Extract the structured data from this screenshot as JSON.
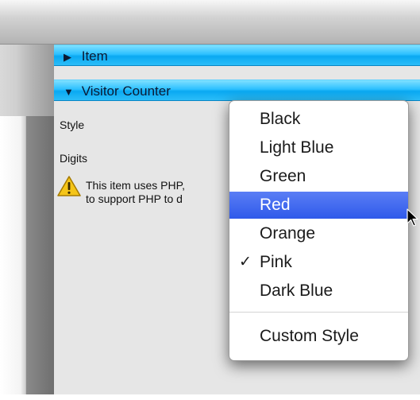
{
  "inspector": {
    "sections": [
      {
        "label": "Item",
        "expanded": false
      },
      {
        "label": "Visitor Counter",
        "expanded": true
      }
    ],
    "style_label": "Style",
    "digits_label": "Digits",
    "warning_text": "This item uses PHP,\nto support PHP to d"
  },
  "menu": {
    "items": [
      {
        "label": "Black",
        "checked": false,
        "highlighted": false
      },
      {
        "label": "Light Blue",
        "checked": false,
        "highlighted": false
      },
      {
        "label": "Green",
        "checked": false,
        "highlighted": false
      },
      {
        "label": "Red",
        "checked": false,
        "highlighted": true
      },
      {
        "label": "Orange",
        "checked": false,
        "highlighted": false
      },
      {
        "label": "Pink",
        "checked": true,
        "highlighted": false
      },
      {
        "label": "Dark Blue",
        "checked": false,
        "highlighted": false
      }
    ],
    "footer_item": "Custom Style",
    "check_glyph": "✓"
  },
  "colors": {
    "section_header": "#1db6fb",
    "highlight": "#3a63ee",
    "warning_fill": "#f5c518"
  },
  "icons": {
    "collapsed": "triangle-right-icon",
    "expanded": "triangle-down-icon",
    "warning": "warning-icon",
    "cursor": "pointer-icon"
  }
}
